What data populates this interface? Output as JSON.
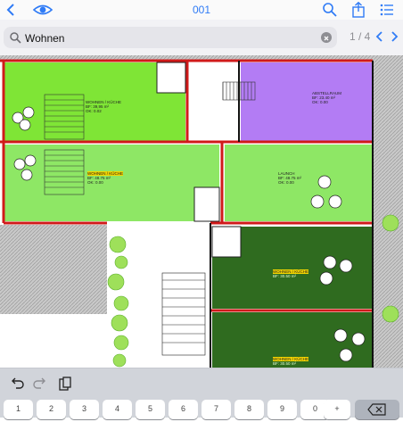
{
  "header": {
    "title": "001",
    "view_icon": "eye-icon",
    "search_icon": "magnifier-icon",
    "share_icon": "share-icon",
    "menu_icon": "list-menu-icon"
  },
  "search": {
    "value": "Wohnen",
    "match_count": "1 / 4"
  },
  "plan": {
    "labels": [
      {
        "line1": "WOHNEN / KÜCHE",
        "line2": "BF:  39,95 m²",
        "line3": "OK:  0.02",
        "highlight": "WOHNEN"
      },
      {
        "line1": "ABSTELLRAUM",
        "line2": "BF:  23.40 m²",
        "line3": "OK:  0.00"
      },
      {
        "line1": "WOHNEN / KÜCHE",
        "line2": "BF:  48.75 m²",
        "line3": "OK:  0.00",
        "highlight": "WOHNEN"
      },
      {
        "line1": "LAUNCH",
        "line2": "BF:  48.75 m²",
        "line3": "OK:  0.00"
      },
      {
        "line1": "WOHNEN / KÜCHE",
        "line2": "BF:  30.50 m²",
        "line3": "",
        "highlight": "WOHNEN"
      },
      {
        "line1": "WOHNEN / KÜCHE",
        "line2": "BF:  30.50 m²",
        "line3": "",
        "highlight": "WOHNEN"
      }
    ],
    "colors": {
      "light_green": "#8ee765",
      "bright_green": "#7fe536",
      "purple": "#b37cf4",
      "dark_green": "#2f6b1f",
      "wall_red": "#d01a1a",
      "tree_green": "#9ee05a"
    }
  },
  "keyboard": {
    "tools": [
      "undo-icon",
      "redo-icon",
      "paste-icon"
    ],
    "number_keys": [
      "1",
      "2",
      "3",
      "4",
      "5",
      "6",
      "7",
      "8",
      "9",
      "0",
      "+"
    ]
  }
}
